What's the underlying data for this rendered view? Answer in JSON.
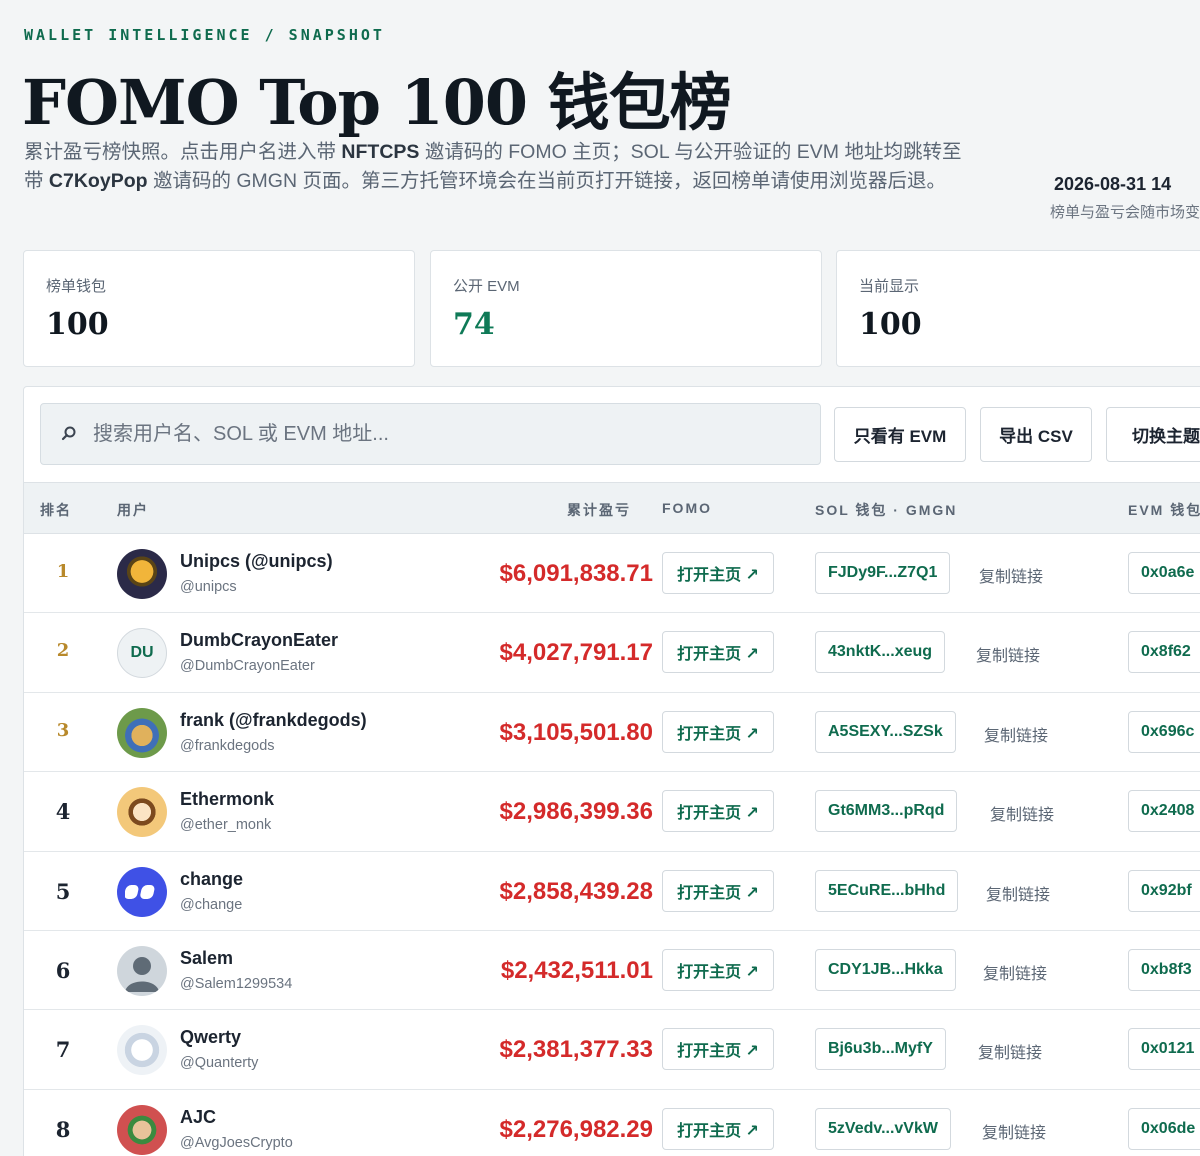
{
  "header": {
    "eyebrow": "WALLET INTELLIGENCE / SNAPSHOT",
    "title": "FOMO Top 100 钱包榜",
    "desc_1": "累计盈亏榜快照。点击用户名进入带 ",
    "desc_code1": "NFTCPS",
    "desc_2": " 邀请码的 FOMO 主页；SOL 与公开验证的 EVM 地址均跳转至带 ",
    "desc_code2": "C7KoyPop",
    "desc_3": " 邀请码的 GMGN 页面。第三方托管环境会在当前页打开链接，返回榜单请使用浏览器后退。",
    "date": "2026-08-31 14",
    "note": "榜单与盈亏会随市场变"
  },
  "stats": [
    {
      "label": "榜单钱包",
      "value": "100"
    },
    {
      "label": "公开 EVM",
      "value": "74"
    },
    {
      "label": "当前显示",
      "value": "100"
    }
  ],
  "toolbar": {
    "search_placeholder": "搜索用户名、SOL 或 EVM 地址...",
    "evm_only": "只看有 EVM",
    "export": "导出 CSV",
    "theme": "切换主题"
  },
  "columns": {
    "rank": "排名",
    "user": "用户",
    "pnl": "累计盈亏",
    "fomo": "FOMO",
    "sol": "SOL 钱包 · GMGN",
    "evm": "EVM 钱包"
  },
  "row_labels": {
    "fomo_button": "打开主页 ↗",
    "copy_link": "复制链接"
  },
  "rows": [
    {
      "rank": "1",
      "name": "Unipcs (@unipcs)",
      "handle": "@unipcs",
      "pnl": "$6,091,838.71",
      "sol": "FJDy9F...Z7Q1",
      "evm": "0x0a6e"
    },
    {
      "rank": "2",
      "name": "DumbCrayonEater",
      "handle": "@DumbCrayonEater",
      "pnl": "$4,027,791.17",
      "sol": "43nktK...xeug",
      "evm": "0x8f62",
      "initials": "DU"
    },
    {
      "rank": "3",
      "name": "frank (@frankdegods)",
      "handle": "@frankdegods",
      "pnl": "$3,105,501.80",
      "sol": "A5SEXY...SZSk",
      "evm": "0x696c"
    },
    {
      "rank": "4",
      "name": "Ethermonk",
      "handle": "@ether_monk",
      "pnl": "$2,986,399.36",
      "sol": "Gt6MM3...pRqd",
      "evm": "0x2408"
    },
    {
      "rank": "5",
      "name": "change",
      "handle": "@change",
      "pnl": "$2,858,439.28",
      "sol": "5ECuRE...bHhd",
      "evm": "0x92bf"
    },
    {
      "rank": "6",
      "name": "Salem",
      "handle": "@Salem1299534",
      "pnl": "$2,432,511.01",
      "sol": "CDY1JB...Hkka",
      "evm": "0xb8f3"
    },
    {
      "rank": "7",
      "name": "Qwerty",
      "handle": "@Quanterty",
      "pnl": "$2,381,377.33",
      "sol": "Bj6u3b...MyfY",
      "evm": "0x0121"
    },
    {
      "rank": "8",
      "name": "AJC",
      "handle": "@AvgJoesCrypto",
      "pnl": "$2,276,982.29",
      "sol": "5zVedv...vVkW",
      "evm": "0x06de"
    }
  ],
  "colors": {
    "accent": "#0f6b4e",
    "loss_gain": "#d42a2a",
    "gold_rank": "#b8892b"
  }
}
